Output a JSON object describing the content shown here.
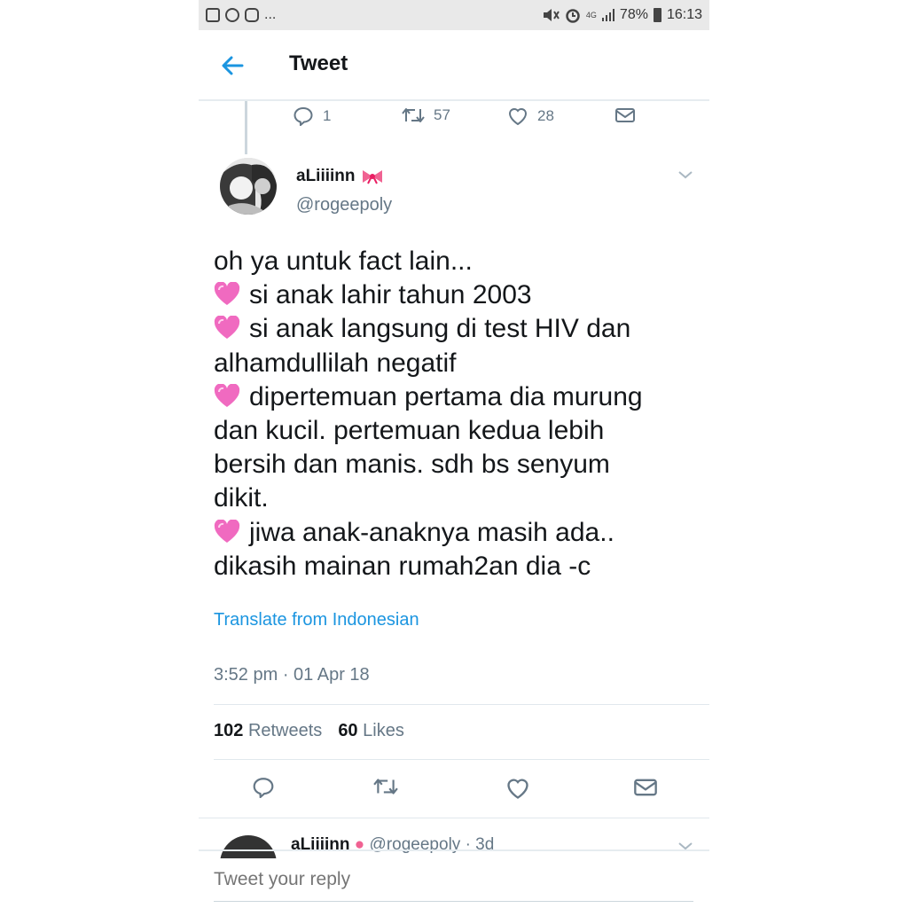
{
  "status_bar": {
    "left_more": "...",
    "network": "4G",
    "battery": "78%",
    "time": "16:13"
  },
  "header": {
    "title": "Tweet"
  },
  "previous_tweet_actions": {
    "replies": "1",
    "retweets": "57",
    "likes": "28"
  },
  "tweet": {
    "display_name": "aLiiiinn",
    "handle": "@rogeepoly",
    "lines": [
      {
        "emoji": false,
        "text": "oh ya untuk fact lain..."
      },
      {
        "emoji": true,
        "text": "si anak lahir tahun 2003"
      },
      {
        "emoji": true,
        "text": "si anak langsung di test HIV dan"
      },
      {
        "emoji": false,
        "text": "alhamdullilah negatif"
      },
      {
        "emoji": true,
        "text": "dipertemuan pertama dia murung"
      },
      {
        "emoji": false,
        "text": "dan kucil. pertemuan kedua lebih"
      },
      {
        "emoji": false,
        "text": "bersih dan manis. sdh bs senyum"
      },
      {
        "emoji": false,
        "text": "dikit."
      },
      {
        "emoji": true,
        "text": "jiwa anak-anaknya masih ada.."
      },
      {
        "emoji": false,
        "text": "dikasih mainan rumah2an dia -c"
      }
    ],
    "translate_label": "Translate from Indonesian",
    "timestamp": "3:52 pm · 01 Apr 18",
    "retweet_count": "102",
    "retweet_label": "Retweets",
    "like_count": "60",
    "like_label": "Likes"
  },
  "next_tweet": {
    "display_name": "aLiiiinn",
    "meta": "@rogeepoly · 3d"
  },
  "reply": {
    "placeholder": "Tweet your reply"
  },
  "colors": {
    "accent": "#1b95e0",
    "secondary_text": "#657786",
    "divider": "#e1e8ed",
    "heart_emoji": "#f06ac0",
    "bow_emoji": "#f06292"
  }
}
